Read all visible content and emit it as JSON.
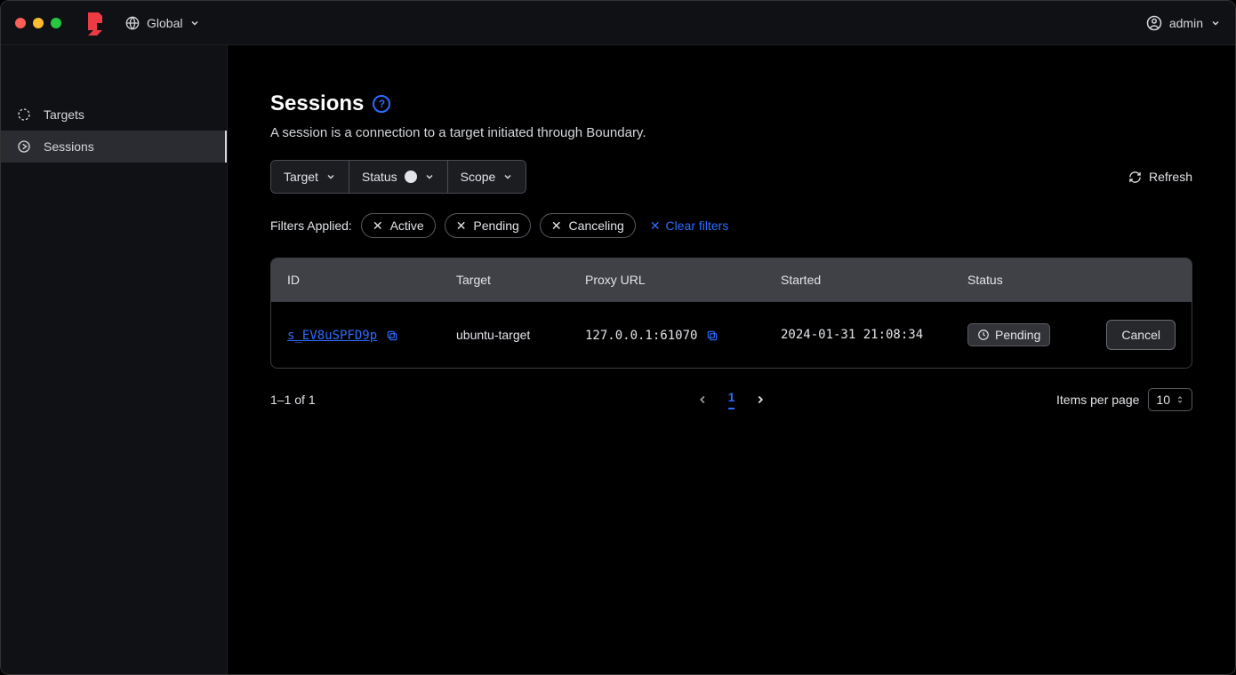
{
  "header": {
    "scope_label": "Global",
    "user_label": "admin"
  },
  "sidebar": {
    "items": [
      {
        "label": "Targets"
      },
      {
        "label": "Sessions"
      }
    ],
    "active_index": 1
  },
  "page": {
    "title": "Sessions",
    "description": "A session is a connection to a target initiated through Boundary."
  },
  "filters": {
    "target_label": "Target",
    "status_label": "Status",
    "scope_label": "Scope",
    "refresh_label": "Refresh",
    "applied_label": "Filters Applied:",
    "applied": [
      "Active",
      "Pending",
      "Canceling"
    ],
    "clear_label": "Clear filters"
  },
  "table": {
    "columns": [
      "ID",
      "Target",
      "Proxy URL",
      "Started",
      "Status"
    ],
    "rows": [
      {
        "id": "s_EV8uSPFD9p",
        "target": "ubuntu-target",
        "proxy_url": "127.0.0.1:61070",
        "started": "2024-01-31 21:08:34",
        "status": "Pending",
        "action_label": "Cancel"
      }
    ]
  },
  "pagination": {
    "summary": "1–1 of 1",
    "current_page": "1",
    "items_per_page_label": "Items per page",
    "items_per_page_value": "10"
  }
}
